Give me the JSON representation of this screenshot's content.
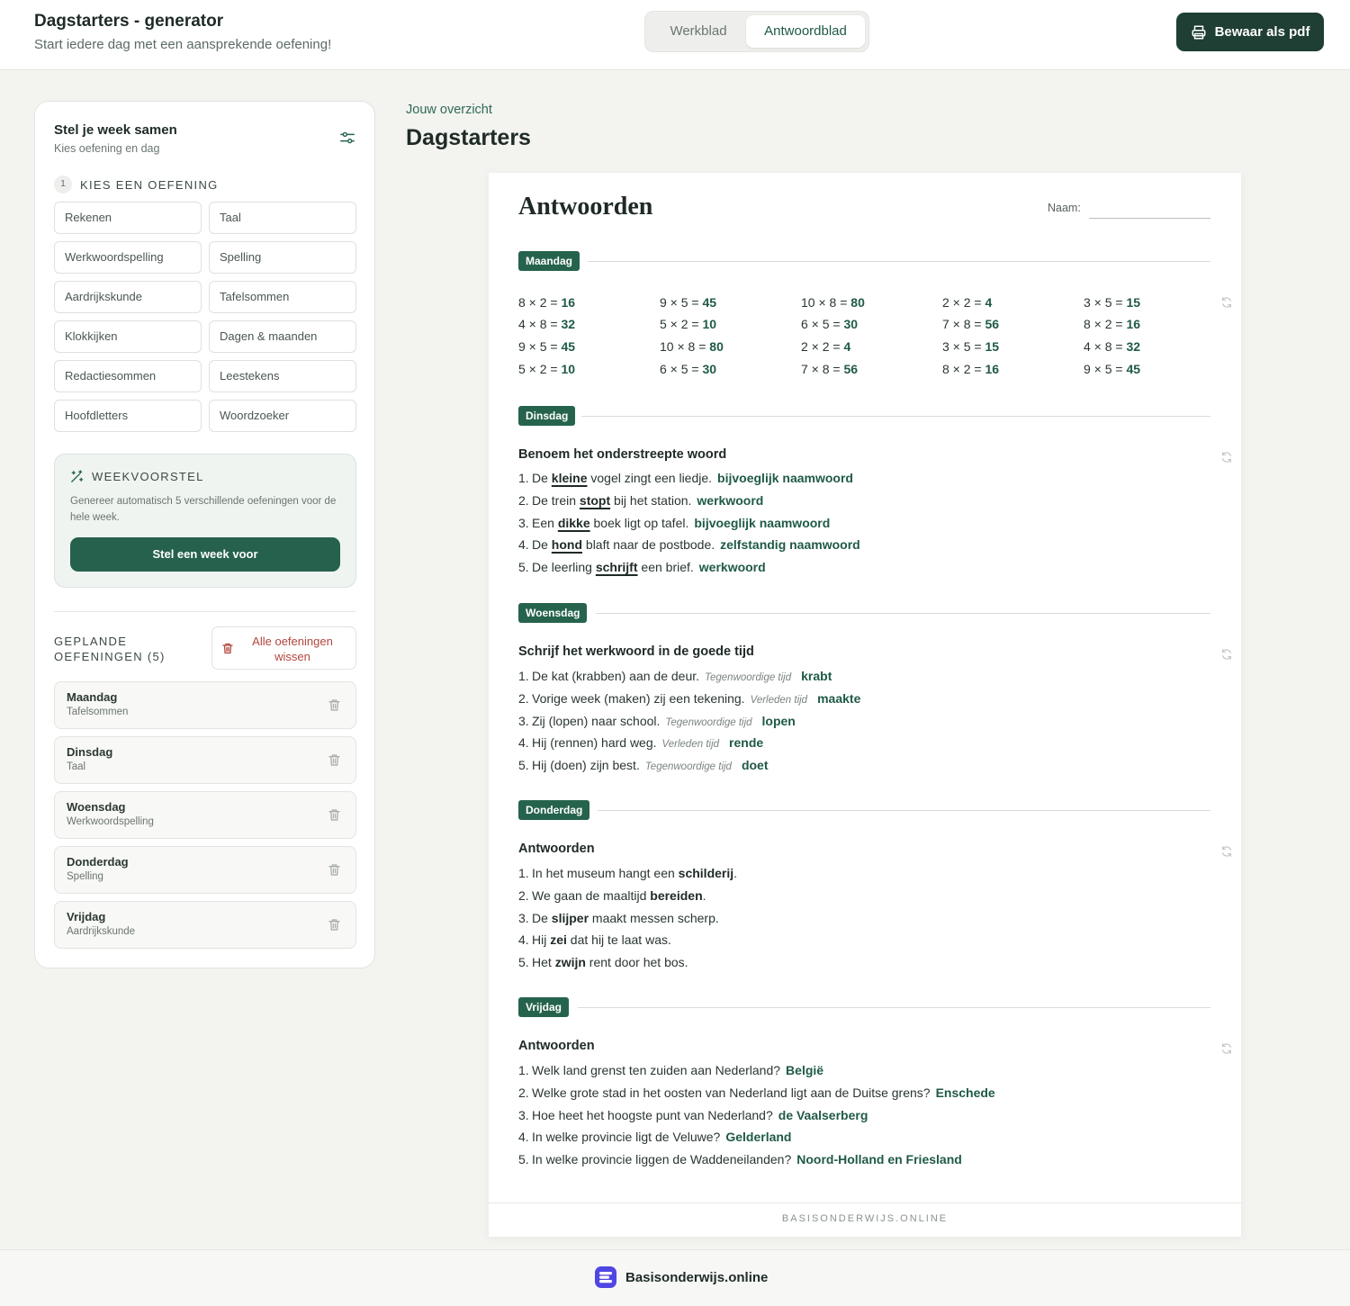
{
  "header": {
    "title": "Dagstarters - generator",
    "subtitle": "Start iedere dag met een aansprekende oefening!",
    "tabs": [
      "Werkblad",
      "Antwoordblad"
    ],
    "active_tab": "Antwoordblad",
    "pdf_button": "Bewaar als pdf"
  },
  "sidebar": {
    "title": "Stel je week samen",
    "subtitle": "Kies oefening en dag",
    "step_number": "1",
    "step_label": "KIES EEN OEFENING",
    "exercises": [
      "Rekenen",
      "Taal",
      "Werkwoordspelling",
      "Spelling",
      "Aardrijkskunde",
      "Tafelsommen",
      "Klokkijken",
      "Dagen & maanden",
      "Redactiesommen",
      "Leestekens",
      "Hoofdletters",
      "Woordzoeker"
    ],
    "week_box": {
      "title": "WEEKVOORSTEL",
      "text": "Genereer automatisch 5 verschillende oefeningen voor de hele week.",
      "button": "Stel een week voor"
    },
    "planned_label": "GEPLANDE OEFENINGEN (5)",
    "clear_button": "Alle oefeningen wissen",
    "planned": [
      {
        "day": "Maandag",
        "exercise": "Tafelsommen"
      },
      {
        "day": "Dinsdag",
        "exercise": "Taal"
      },
      {
        "day": "Woensdag",
        "exercise": "Werkwoordspelling"
      },
      {
        "day": "Donderdag",
        "exercise": "Spelling"
      },
      {
        "day": "Vrijdag",
        "exercise": "Aardrijkskunde"
      }
    ]
  },
  "main": {
    "breadcrumb": "Jouw overzicht",
    "title": "Dagstarters"
  },
  "sheet": {
    "title": "Antwoorden",
    "name_label": "Naam:",
    "footer": "BASISONDERWIJS.ONLINE",
    "maandag": {
      "day": "Maandag",
      "rows": [
        [
          [
            "8 × 2 = ",
            "16"
          ],
          [
            "9 × 5 = ",
            "45"
          ],
          [
            "10 × 8 = ",
            "80"
          ],
          [
            "2 × 2 = ",
            "4"
          ],
          [
            "3 × 5 = ",
            "15"
          ]
        ],
        [
          [
            "4 × 8 = ",
            "32"
          ],
          [
            "5 × 2 = ",
            "10"
          ],
          [
            "6 × 5 = ",
            "30"
          ],
          [
            "7 × 8 = ",
            "56"
          ],
          [
            "8 × 2 = ",
            "16"
          ]
        ],
        [
          [
            "9 × 5 = ",
            "45"
          ],
          [
            "10 × 8 = ",
            "80"
          ],
          [
            "2 × 2 = ",
            "4"
          ],
          [
            "3 × 5 = ",
            "15"
          ],
          [
            "4 × 8 = ",
            "32"
          ]
        ],
        [
          [
            "5 × 2 = ",
            "10"
          ],
          [
            "6 × 5 = ",
            "30"
          ],
          [
            "7 × 8 = ",
            "56"
          ],
          [
            "8 × 2 = ",
            "16"
          ],
          [
            "9 × 5 = ",
            "45"
          ]
        ]
      ]
    },
    "dinsdag": {
      "day": "Dinsdag",
      "title": "Benoem het onderstreepte woord",
      "items": [
        {
          "n": "1.",
          "pre": "De ",
          "word": "kleine",
          "post": " vogel zingt een liedje.",
          "answer": "bijvoeglijk naamwoord"
        },
        {
          "n": "2.",
          "pre": "De trein ",
          "word": "stopt",
          "post": " bij het station.",
          "answer": "werkwoord"
        },
        {
          "n": "3.",
          "pre": "Een ",
          "word": "dikke",
          "post": " boek ligt op tafel.",
          "answer": "bijvoeglijk naamwoord"
        },
        {
          "n": "4.",
          "pre": "De ",
          "word": "hond",
          "post": " blaft naar de postbode.",
          "answer": "zelfstandig naamwoord"
        },
        {
          "n": "5.",
          "pre": "De leerling ",
          "word": "schrijft",
          "post": " een brief.",
          "answer": "werkwoord"
        }
      ]
    },
    "woensdag": {
      "day": "Woensdag",
      "title": "Schrijf het werkwoord in de goede tijd",
      "items": [
        {
          "n": "1.",
          "text": "De kat (krabben) aan de deur.",
          "hint": "Tegenwoordige tijd",
          "answer": "krabt"
        },
        {
          "n": "2.",
          "text": "Vorige week (maken) zij een tekening.",
          "hint": "Verleden tijd",
          "answer": "maakte"
        },
        {
          "n": "3.",
          "text": "Zij (lopen) naar school.",
          "hint": "Tegenwoordige tijd",
          "answer": "lopen"
        },
        {
          "n": "4.",
          "text": "Hij (rennen) hard weg.",
          "hint": "Verleden tijd",
          "answer": "rende"
        },
        {
          "n": "5.",
          "text": "Hij (doen) zijn best.",
          "hint": "Tegenwoordige tijd",
          "answer": "doet"
        }
      ]
    },
    "donderdag": {
      "day": "Donderdag",
      "title": "Antwoorden",
      "items": [
        {
          "n": "1.",
          "pre": "In het museum hangt een ",
          "word": "schilderij",
          "post": "."
        },
        {
          "n": "2.",
          "pre": "We gaan de maaltijd ",
          "word": "bereiden",
          "post": "."
        },
        {
          "n": "3.",
          "pre": "De ",
          "word": "slijper",
          "post": " maakt messen scherp."
        },
        {
          "n": "4.",
          "pre": "Hij ",
          "word": "zei",
          "post": " dat hij te laat was."
        },
        {
          "n": "5.",
          "pre": "Het ",
          "word": "zwijn",
          "post": " rent door het bos."
        }
      ]
    },
    "vrijdag": {
      "day": "Vrijdag",
      "title": "Antwoorden",
      "items": [
        {
          "n": "1.",
          "text": "Welk land grenst ten zuiden aan Nederland?",
          "answer": "België"
        },
        {
          "n": "2.",
          "text": "Welke grote stad in het oosten van Nederland ligt aan de Duitse grens?",
          "answer": "Enschede"
        },
        {
          "n": "3.",
          "text": "Hoe heet het hoogste punt van Nederland?",
          "answer": "de Vaalserberg"
        },
        {
          "n": "4.",
          "text": "In welke provincie ligt de Veluwe?",
          "answer": "Gelderland"
        },
        {
          "n": "5.",
          "text": "In welke provincie liggen de Waddeneilanden?",
          "answer": "Noord-Holland en Friesland"
        }
      ]
    }
  },
  "footer": {
    "brand": "Basisonderwijs.online"
  },
  "colors": {
    "accent": "#26634d",
    "dark": "#1f3e34",
    "danger": "#b2453d",
    "brand": "#4f46e5"
  }
}
